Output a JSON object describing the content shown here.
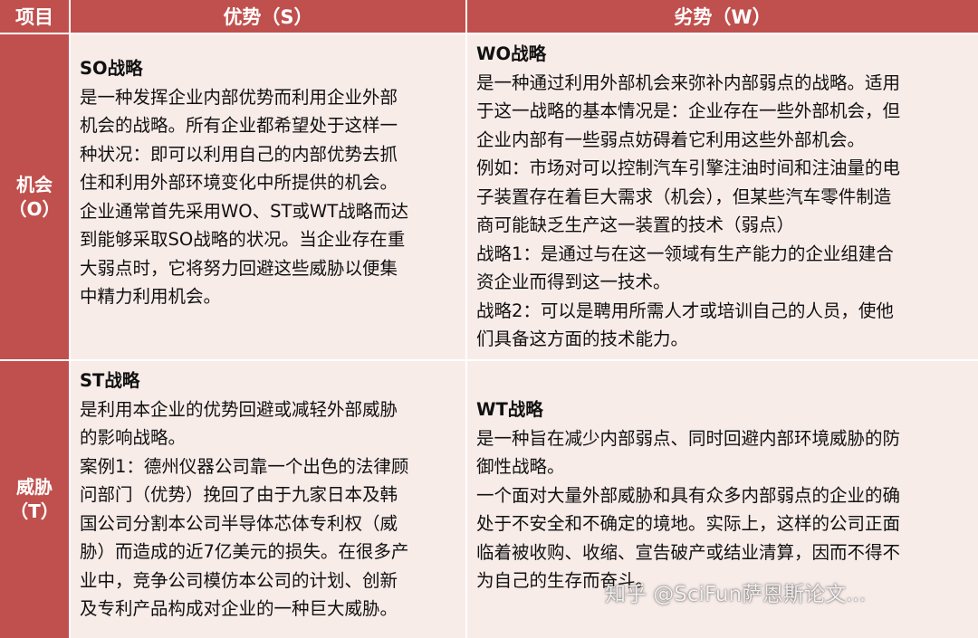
{
  "header": {
    "col0": "项目",
    "col1": "优势（S）",
    "col2": "劣势（W）"
  },
  "rows": [
    {
      "label_line1": "机会",
      "label_line2": "（O）",
      "so": {
        "title": "SO战略",
        "lines": [
          "是一种发挥企业内部优势而利用企业外部",
          "机会的战略。所有企业都希望处于这样一",
          "种状况：即可以利用自己的内部优势去抓",
          "住和利用外部环境变化中所提供的机会。",
          "企业通常首先采用WO、ST或WT战略而达",
          "到能够采取SO战略的状况。当企业存在重",
          "大弱点时，它将努力回避这些威胁以便集",
          "中精力利用机会。"
        ]
      },
      "wo": {
        "title": "WO战略",
        "lines": [
          "是一种通过利用外部机会来弥补内部弱点的战略。适用",
          "于这一战略的基本情况是：企业存在一些外部机会，但",
          "企业内部有一些弱点妨碍着它利用这些外部机会。",
          "例如：市场对可以控制汽车引擎注油时间和注油量的电",
          "子装置存在着巨大需求（机会），但某些汽车零件制造",
          "商可能缺乏生产这一装置的技术（弱点）",
          "战略1：是通过与在这一领域有生产能力的企业组建合",
          "资企业而得到这一技术。",
          "战略2：可以是聘用所需人才或培训自己的人员，使他",
          "们具备这方面的技术能力。"
        ]
      }
    },
    {
      "label_line1": "威胁",
      "label_line2": "（T）",
      "st": {
        "title": "ST战略",
        "lines": [
          "是利用本企业的优势回避或减轻外部威胁",
          "的影响战略。",
          "案例1：德州仪器公司靠一个出色的法律顾",
          "问部门（优势）挽回了由于九家日本及韩",
          "国公司分割本公司半导体芯体专利权（威",
          "胁）而造成的近7亿美元的损失。在很多产",
          "业中，竞争公司模仿本公司的计划、创新",
          "及专利产品构成对企业的一种巨大威胁。"
        ]
      },
      "wt": {
        "title": "WT战略",
        "lines": [
          "是一种旨在减少内部弱点、同时回避内部环境威胁的防",
          "御性战略。",
          "一个面对大量外部威胁和具有众多内部弱点的企业的确",
          "处于不安全和不确定的境地。实际上，这样的公司正面",
          "临着被收购、收缩、宣告破产或结业清算，因而不得不",
          "为自己的生存而奋斗。"
        ]
      }
    }
  ],
  "watermark": "知乎 @SciFun萨恩斯论文..."
}
